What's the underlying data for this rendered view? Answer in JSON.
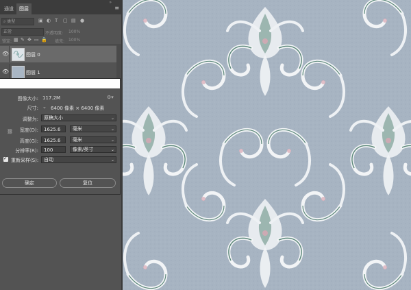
{
  "tabs": [
    {
      "label": "通道",
      "active": false
    },
    {
      "label": "图层",
      "active": true
    }
  ],
  "panel": {
    "menu_icon": "hamburger-menu-icon",
    "collapse_icon": "double-chevron-icon",
    "search_placeholder": "类型",
    "blend_mode": "正常",
    "opacity_label": "不透明度:",
    "opacity_value": "100%",
    "lock_label": "锁定:",
    "fill_label": "填充:",
    "fill_value": "100%"
  },
  "layers": [
    {
      "name": "图层 0",
      "visible": true,
      "selected": true
    },
    {
      "name": "图层 1",
      "visible": true,
      "selected": false
    }
  ],
  "dialog": {
    "image_size_label": "图像大小:",
    "image_size_value": "117.2M",
    "dimensions_label": "尺寸:",
    "dimensions_value": "6400 像素 × 6400 像素",
    "fit_label": "调整为:",
    "fit_value": "原稿大小",
    "width_label": "宽度(D):",
    "width_value": "1625.6",
    "width_unit": "毫米",
    "height_label": "高度(G):",
    "height_value": "1625.6",
    "height_unit": "毫米",
    "resolution_label": "分辨率(R):",
    "resolution_value": "100",
    "resolution_unit": "像素/英寸",
    "resample_label": "重新采样(S):",
    "resample_checked": true,
    "resample_value": "自动",
    "ok_label": "确定",
    "reset_label": "复位"
  },
  "colors": {
    "panel_bg": "#535353",
    "canvas_bg": "#a7b4c2",
    "pattern_white": "#f2f4f6",
    "pattern_green": "#5f8a7c",
    "pattern_pink": "#d9a7b4"
  }
}
